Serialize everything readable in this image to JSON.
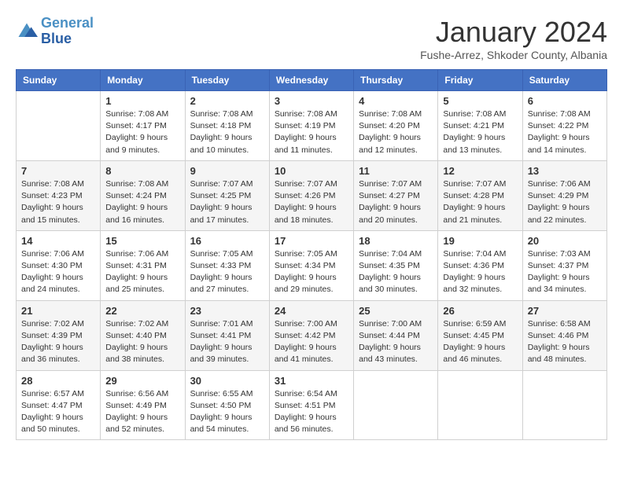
{
  "logo": {
    "line1": "General",
    "line2": "Blue"
  },
  "title": "January 2024",
  "location": "Fushe-Arrez, Shkoder County, Albania",
  "weekdays": [
    "Sunday",
    "Monday",
    "Tuesday",
    "Wednesday",
    "Thursday",
    "Friday",
    "Saturday"
  ],
  "weeks": [
    [
      {
        "day": "",
        "sunrise": "",
        "sunset": "",
        "daylight": ""
      },
      {
        "day": "1",
        "sunrise": "Sunrise: 7:08 AM",
        "sunset": "Sunset: 4:17 PM",
        "daylight": "Daylight: 9 hours and 9 minutes."
      },
      {
        "day": "2",
        "sunrise": "Sunrise: 7:08 AM",
        "sunset": "Sunset: 4:18 PM",
        "daylight": "Daylight: 9 hours and 10 minutes."
      },
      {
        "day": "3",
        "sunrise": "Sunrise: 7:08 AM",
        "sunset": "Sunset: 4:19 PM",
        "daylight": "Daylight: 9 hours and 11 minutes."
      },
      {
        "day": "4",
        "sunrise": "Sunrise: 7:08 AM",
        "sunset": "Sunset: 4:20 PM",
        "daylight": "Daylight: 9 hours and 12 minutes."
      },
      {
        "day": "5",
        "sunrise": "Sunrise: 7:08 AM",
        "sunset": "Sunset: 4:21 PM",
        "daylight": "Daylight: 9 hours and 13 minutes."
      },
      {
        "day": "6",
        "sunrise": "Sunrise: 7:08 AM",
        "sunset": "Sunset: 4:22 PM",
        "daylight": "Daylight: 9 hours and 14 minutes."
      }
    ],
    [
      {
        "day": "7",
        "sunrise": "Sunrise: 7:08 AM",
        "sunset": "Sunset: 4:23 PM",
        "daylight": "Daylight: 9 hours and 15 minutes."
      },
      {
        "day": "8",
        "sunrise": "Sunrise: 7:08 AM",
        "sunset": "Sunset: 4:24 PM",
        "daylight": "Daylight: 9 hours and 16 minutes."
      },
      {
        "day": "9",
        "sunrise": "Sunrise: 7:07 AM",
        "sunset": "Sunset: 4:25 PM",
        "daylight": "Daylight: 9 hours and 17 minutes."
      },
      {
        "day": "10",
        "sunrise": "Sunrise: 7:07 AM",
        "sunset": "Sunset: 4:26 PM",
        "daylight": "Daylight: 9 hours and 18 minutes."
      },
      {
        "day": "11",
        "sunrise": "Sunrise: 7:07 AM",
        "sunset": "Sunset: 4:27 PM",
        "daylight": "Daylight: 9 hours and 20 minutes."
      },
      {
        "day": "12",
        "sunrise": "Sunrise: 7:07 AM",
        "sunset": "Sunset: 4:28 PM",
        "daylight": "Daylight: 9 hours and 21 minutes."
      },
      {
        "day": "13",
        "sunrise": "Sunrise: 7:06 AM",
        "sunset": "Sunset: 4:29 PM",
        "daylight": "Daylight: 9 hours and 22 minutes."
      }
    ],
    [
      {
        "day": "14",
        "sunrise": "Sunrise: 7:06 AM",
        "sunset": "Sunset: 4:30 PM",
        "daylight": "Daylight: 9 hours and 24 minutes."
      },
      {
        "day": "15",
        "sunrise": "Sunrise: 7:06 AM",
        "sunset": "Sunset: 4:31 PM",
        "daylight": "Daylight: 9 hours and 25 minutes."
      },
      {
        "day": "16",
        "sunrise": "Sunrise: 7:05 AM",
        "sunset": "Sunset: 4:33 PM",
        "daylight": "Daylight: 9 hours and 27 minutes."
      },
      {
        "day": "17",
        "sunrise": "Sunrise: 7:05 AM",
        "sunset": "Sunset: 4:34 PM",
        "daylight": "Daylight: 9 hours and 29 minutes."
      },
      {
        "day": "18",
        "sunrise": "Sunrise: 7:04 AM",
        "sunset": "Sunset: 4:35 PM",
        "daylight": "Daylight: 9 hours and 30 minutes."
      },
      {
        "day": "19",
        "sunrise": "Sunrise: 7:04 AM",
        "sunset": "Sunset: 4:36 PM",
        "daylight": "Daylight: 9 hours and 32 minutes."
      },
      {
        "day": "20",
        "sunrise": "Sunrise: 7:03 AM",
        "sunset": "Sunset: 4:37 PM",
        "daylight": "Daylight: 9 hours and 34 minutes."
      }
    ],
    [
      {
        "day": "21",
        "sunrise": "Sunrise: 7:02 AM",
        "sunset": "Sunset: 4:39 PM",
        "daylight": "Daylight: 9 hours and 36 minutes."
      },
      {
        "day": "22",
        "sunrise": "Sunrise: 7:02 AM",
        "sunset": "Sunset: 4:40 PM",
        "daylight": "Daylight: 9 hours and 38 minutes."
      },
      {
        "day": "23",
        "sunrise": "Sunrise: 7:01 AM",
        "sunset": "Sunset: 4:41 PM",
        "daylight": "Daylight: 9 hours and 39 minutes."
      },
      {
        "day": "24",
        "sunrise": "Sunrise: 7:00 AM",
        "sunset": "Sunset: 4:42 PM",
        "daylight": "Daylight: 9 hours and 41 minutes."
      },
      {
        "day": "25",
        "sunrise": "Sunrise: 7:00 AM",
        "sunset": "Sunset: 4:44 PM",
        "daylight": "Daylight: 9 hours and 43 minutes."
      },
      {
        "day": "26",
        "sunrise": "Sunrise: 6:59 AM",
        "sunset": "Sunset: 4:45 PM",
        "daylight": "Daylight: 9 hours and 46 minutes."
      },
      {
        "day": "27",
        "sunrise": "Sunrise: 6:58 AM",
        "sunset": "Sunset: 4:46 PM",
        "daylight": "Daylight: 9 hours and 48 minutes."
      }
    ],
    [
      {
        "day": "28",
        "sunrise": "Sunrise: 6:57 AM",
        "sunset": "Sunset: 4:47 PM",
        "daylight": "Daylight: 9 hours and 50 minutes."
      },
      {
        "day": "29",
        "sunrise": "Sunrise: 6:56 AM",
        "sunset": "Sunset: 4:49 PM",
        "daylight": "Daylight: 9 hours and 52 minutes."
      },
      {
        "day": "30",
        "sunrise": "Sunrise: 6:55 AM",
        "sunset": "Sunset: 4:50 PM",
        "daylight": "Daylight: 9 hours and 54 minutes."
      },
      {
        "day": "31",
        "sunrise": "Sunrise: 6:54 AM",
        "sunset": "Sunset: 4:51 PM",
        "daylight": "Daylight: 9 hours and 56 minutes."
      },
      {
        "day": "",
        "sunrise": "",
        "sunset": "",
        "daylight": ""
      },
      {
        "day": "",
        "sunrise": "",
        "sunset": "",
        "daylight": ""
      },
      {
        "day": "",
        "sunrise": "",
        "sunset": "",
        "daylight": ""
      }
    ]
  ]
}
